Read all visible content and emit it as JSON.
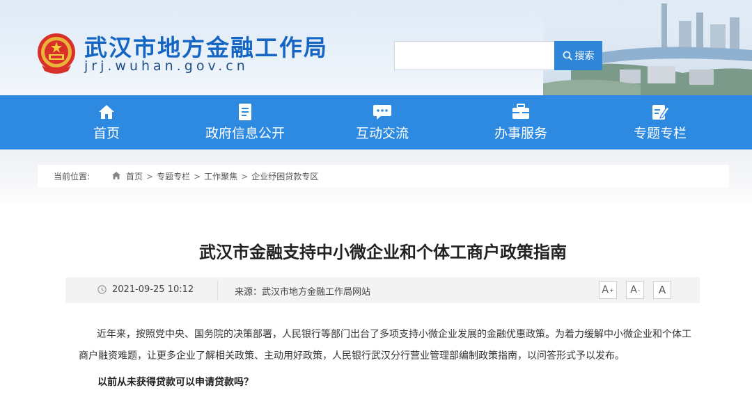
{
  "header": {
    "site_title": "武汉市地方金融工作局",
    "site_domain": "jrj.wuhan.gov.cn"
  },
  "search": {
    "placeholder": "",
    "button_label": "搜索"
  },
  "nav": {
    "items": [
      {
        "label": "首页",
        "icon": "home-icon"
      },
      {
        "label": "政府信息公开",
        "icon": "document-icon"
      },
      {
        "label": "互动交流",
        "icon": "chat-icon"
      },
      {
        "label": "办事服务",
        "icon": "briefcase-icon"
      },
      {
        "label": "专题专栏",
        "icon": "edit-icon"
      }
    ]
  },
  "breadcrumb": {
    "label": "当前位置:",
    "items": [
      "首页",
      "专题专栏",
      "工作聚焦",
      "企业纾困贷款专区"
    ],
    "separator": ">"
  },
  "article": {
    "title": "武汉市金融支持中小微企业和个体工商户政策指南",
    "date": "2021-09-25 10:12",
    "source": "来源：武汉市地方金融工作局网站",
    "font_size_buttons": [
      "A+",
      "A-",
      "A"
    ],
    "paragraph": "近年来，按照党中央、国务院的决策部署，人民银行等部门出台了多项支持小微企业发展的金融优惠政策。为着力缓解中小微企业和个体工商户融资难题，让更多企业了解相关政策、主动用好政策，人民银行武汉分行营业管理部编制政策指南，以问答形式予以发布。",
    "question": "以前从未获得贷款可以申请贷款吗？"
  },
  "colors": {
    "nav_blue": "#2d8ae0",
    "title_blue": "#1566c4",
    "search_button": "#2f86d9"
  }
}
